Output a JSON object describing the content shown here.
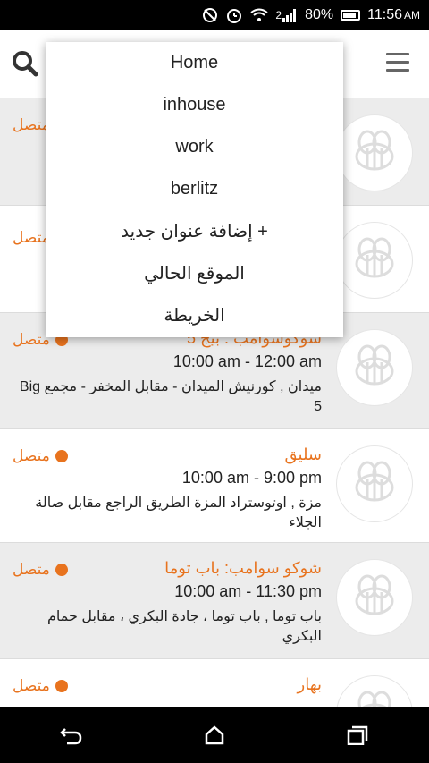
{
  "status_bar": {
    "battery": "80%",
    "time": "11:56",
    "ampm": "AM",
    "signal_label": "2"
  },
  "header": {
    "search_icon": "search-icon",
    "menu_icon": "hamburger-icon"
  },
  "dropdown": {
    "items": [
      {
        "label": "Home"
      },
      {
        "label": "inhouse"
      },
      {
        "label": "work"
      },
      {
        "label": "berlitz"
      },
      {
        "label": "+ إضافة عنوان جديد"
      },
      {
        "label": "الموقع الحالي"
      },
      {
        "label": "الخريطة"
      }
    ]
  },
  "list": {
    "rows": [
      {
        "name": "",
        "hours": "",
        "address": "",
        "status": "متصل"
      },
      {
        "name": "",
        "hours": "",
        "address": "",
        "status": "متصل"
      },
      {
        "name": "شوكوسوامب . بيج 5",
        "hours": "10:00 am - 12:00 am",
        "address": "ميدان , كورنيش الميدان - مقابل المخفر - مجمع Big 5",
        "status": "متصل"
      },
      {
        "name": "سليق",
        "hours": "10:00 am - 9:00 pm",
        "address": "مزة , اوتوستراد المزة الطريق الراجع  مقابل صالة الجلاء",
        "status": "متصل"
      },
      {
        "name": "شوكو سوامب: باب توما",
        "hours": "10:00 am - 11:30 pm",
        "address": "باب توما , باب توما ، جادة البكري ، مقابل حمام البكري",
        "status": "متصل"
      },
      {
        "name": "بهار",
        "hours": "",
        "address": "",
        "status": "متصل"
      }
    ]
  },
  "colors": {
    "accent": "#e8731e",
    "row_gray": "#ececec"
  }
}
